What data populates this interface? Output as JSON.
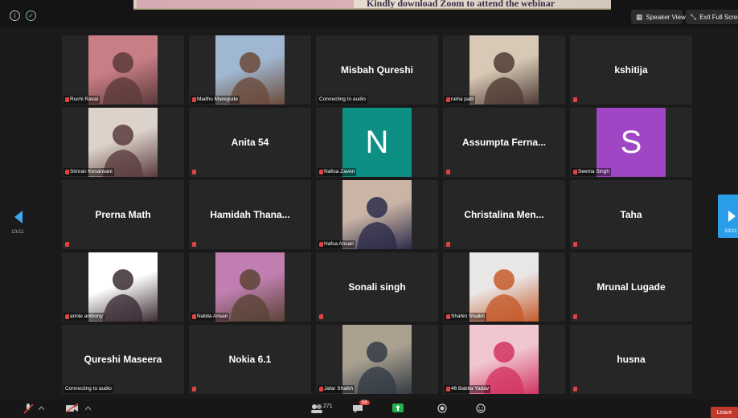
{
  "share_banner": {
    "text": "Kindly download Zoom to attend the webinar"
  },
  "header": {
    "speaker_view": "Speaker View",
    "exit_full_screen": "Exit Full Screen"
  },
  "pager": {
    "left": "10/11",
    "right": "10/11"
  },
  "participants": [
    {
      "name": "Ruchi Raval",
      "kind": "photo",
      "photo_colors": [
        "#c97e86",
        "#5b3a3a"
      ]
    },
    {
      "name": "Madhu Maregude",
      "kind": "photo",
      "photo_colors": [
        "#9fb7d0",
        "#6b4a3b"
      ]
    },
    {
      "name": "Misbah Qureshi",
      "kind": "name",
      "status": "Connecting to audio"
    },
    {
      "name": "neha patil",
      "kind": "photo",
      "photo_colors": [
        "#d7c9b5",
        "#4f3c35"
      ]
    },
    {
      "name": "kshitija",
      "kind": "name"
    },
    {
      "name": "Simran Kesarwani",
      "kind": "photo",
      "photo_colors": [
        "#dcd2ca",
        "#5a3c3c"
      ]
    },
    {
      "name": "Anita 54",
      "kind": "name",
      "mic_only": true
    },
    {
      "name": "Nafisa Zaveri",
      "kind": "avatar",
      "initial": "N",
      "color": "#0e8f84"
    },
    {
      "name": "Assumpta Ferna...",
      "kind": "name",
      "mic_only": true
    },
    {
      "name": "Seema Singh",
      "kind": "avatar",
      "initial": "S",
      "color": "#a046c4"
    },
    {
      "name": "Prerna Math",
      "kind": "name",
      "mic_only": true
    },
    {
      "name": "Hamidah Thana...",
      "kind": "name",
      "mic_only": true
    },
    {
      "name": "Hafsa Ansari",
      "kind": "photo",
      "photo_colors": [
        "#c9b4a5",
        "#2c2b4a"
      ]
    },
    {
      "name": "Christalina Men...",
      "kind": "name",
      "mic_only": true
    },
    {
      "name": "Taha",
      "kind": "name",
      "mic_only": true
    },
    {
      "name": "annie anthony",
      "kind": "photo",
      "photo_colors": [
        "#ffffff",
        "#3b2b33"
      ]
    },
    {
      "name": "Nabila Ansari",
      "kind": "photo",
      "photo_colors": [
        "#c17fb1",
        "#5a4336"
      ]
    },
    {
      "name": "Sonali singh",
      "kind": "name",
      "mic_only": true
    },
    {
      "name": "Shahin Shaikh",
      "kind": "photo",
      "photo_colors": [
        "#e9e6e6",
        "#c55a2a"
      ]
    },
    {
      "name": "Mrunal Lugade",
      "kind": "name",
      "mic_only": true
    },
    {
      "name": "Qureshi Maseera",
      "kind": "name",
      "status": "Connecting to audio"
    },
    {
      "name": "Nokia 6.1",
      "kind": "name",
      "mic_only": true
    },
    {
      "name": "Jafar Shaikh",
      "kind": "photo",
      "photo_colors": [
        "#a9a08f",
        "#333b45"
      ]
    },
    {
      "name": "46 Babita Yadav",
      "kind": "photo",
      "photo_colors": [
        "#f0c7d0",
        "#d23462"
      ]
    },
    {
      "name": "husna",
      "kind": "name",
      "mic_only": true
    }
  ],
  "toolbar": {
    "participants_count": "271",
    "chat_badge": "58",
    "leave": "Leave"
  },
  "colors": {
    "accent": "#2a9ee8",
    "mic_muted": "#e0443e",
    "leave": "#c0392b"
  }
}
